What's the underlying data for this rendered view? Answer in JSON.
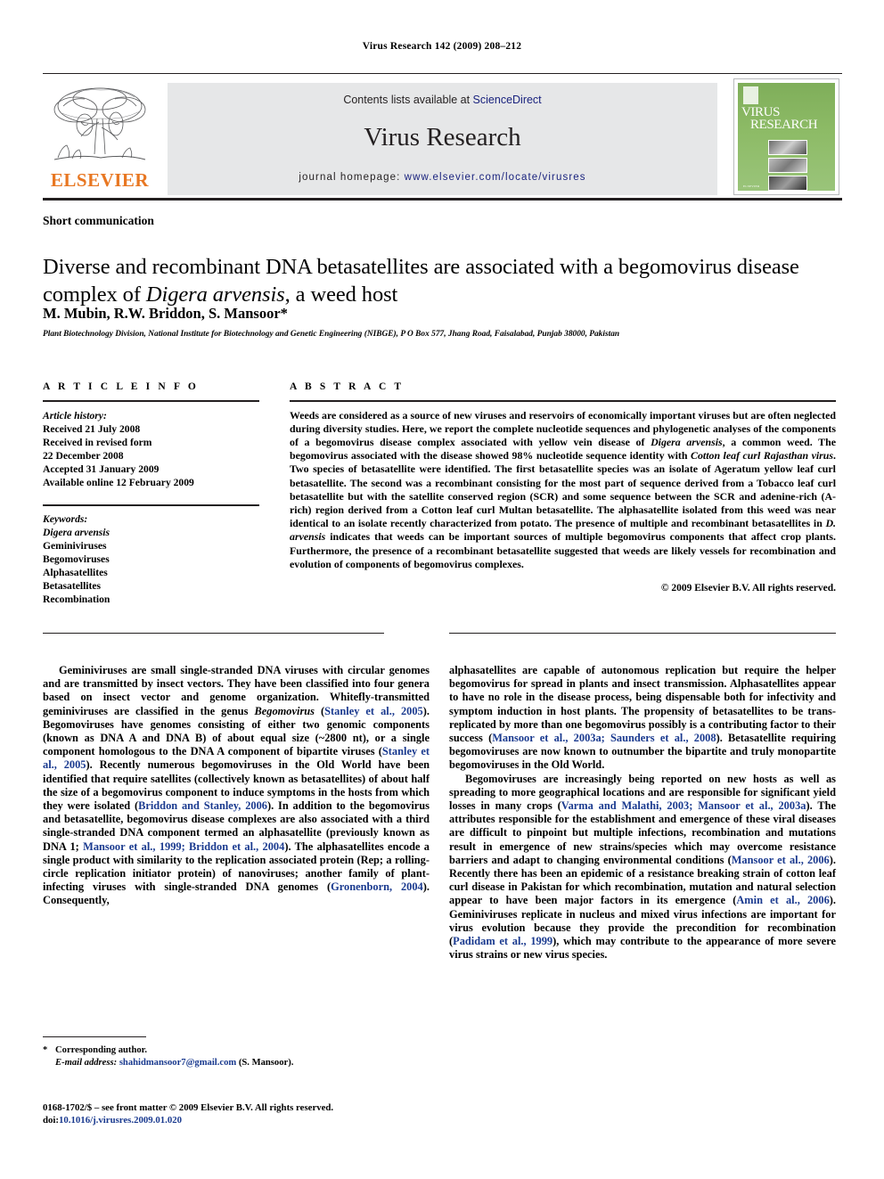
{
  "running_head": "Virus Research 142 (2009) 208–212",
  "masthead": {
    "contents_prefix": "Contents lists available at ",
    "sciencedirect": "ScienceDirect",
    "journal_name": "Virus Research",
    "homepage_prefix": "journal homepage: ",
    "homepage_url": "www.elsevier.com/locate/virusres",
    "publisher_wordmark": "ELSEVIER",
    "cover": {
      "title_line1": "VIRUS",
      "title_line2": "RESEARCH",
      "footer": "ELSEVIER"
    },
    "accent_green": "#8dbb66",
    "accent_orange": "#e87722",
    "link_blue": "#1a237e"
  },
  "article": {
    "section_type": "Short communication",
    "title_part1": "Diverse and recombinant DNA betasatellites are associated with a begomovirus disease complex of ",
    "title_italic": "Digera arvensis",
    "title_part2": ", a weed host",
    "authors": "M. Mubin, R.W. Briddon, S. Mansoor*",
    "affiliation": "Plant Biotechnology Division, National Institute for Biotechnology and Genetic Engineering (NIBGE), P O Box 577, Jhang Road, Faisalabad, Punjab 38000, Pakistan"
  },
  "article_info": {
    "heading": "A R T I C L E  I N F O",
    "history_label": "Article history:",
    "history": [
      "Received 21 July 2008",
      "Received in revised form",
      "22 December 2008",
      "Accepted 31 January 2009",
      "Available online 12 February 2009"
    ],
    "keywords_label": "Keywords:",
    "keywords_italic": "Digera arvensis",
    "keywords": [
      "Geminiviruses",
      "Begomoviruses",
      "Alphasatellites",
      "Betasatellites",
      "Recombination"
    ]
  },
  "abstract": {
    "heading": "A B S T R A C T",
    "p1": "Weeds are considered as a source of new viruses and reservoirs of economically important viruses but are often neglected during diversity studies. Here, we report the complete nucleotide sequences and phylogenetic analyses of the components of a begomovirus disease complex associated with yellow vein disease of ",
    "sp1": "Digera arvensis",
    "p2": ", a common weed. The begomovirus associated with the disease showed 98% nucleotide sequence identity with ",
    "sp2": "Cotton leaf curl Rajasthan virus",
    "p3": ". Two species of betasatellite were identified. The first betasatellite species was an isolate of Ageratum yellow leaf curl betasatellite. The second was a recombinant consisting for the most part of sequence derived from a Tobacco leaf curl betasatellite but with the satellite conserved region (SCR) and some sequence between the SCR and adenine-rich (A-rich) region derived from a Cotton leaf curl Multan betasatellite. The alphasatellite isolated from this weed was near identical to an isolate recently characterized from potato. The presence of multiple and recombinant betasatellites in ",
    "sp3": "D. arvensis",
    "p4": " indicates that weeds can be important sources of multiple begomovirus components that affect crop plants. Furthermore, the presence of a recombinant betasatellite suggested that weeds are likely vessels for recombination and evolution of components of begomovirus complexes.",
    "copyright": "© 2009 Elsevier B.V. All rights reserved."
  },
  "body": {
    "left_p1_a": "Geminiviruses are small single-stranded DNA viruses with circular genomes and are transmitted by insect vectors. They have been classified into four genera based on insect vector and genome organization. Whitefly-transmitted geminiviruses are classified in the genus ",
    "left_p1_genus": "Begomovirus",
    "left_p1_b": " (",
    "left_cite1": "Stanley et al., 2005",
    "left_p1_c": "). Begomoviruses have genomes consisting of either two genomic components (known as DNA A and DNA B) of about equal size (~2800 nt), or a single component homologous to the DNA A component of bipartite viruses (",
    "left_cite2": "Stanley et al., 2005",
    "left_p1_d": "). Recently numerous begomoviruses in the Old World have been identified that require satellites (collectively known as betasatellites) of about half the size of a begomovirus component to induce symptoms in the hosts from which they were isolated (",
    "left_cite3": "Briddon and Stanley, 2006",
    "left_p1_e": "). In addition to the begomovirus and betasatellite, begomovirus disease complexes are also associated with a third single-stranded DNA component termed an alphasatellite (previously known as DNA 1; ",
    "left_cite4": "Mansoor et al., 1999; Briddon et al., 2004",
    "left_p1_f": "). The alphasatellites encode a single product with similarity to the replication associated protein (Rep; a rolling-circle replication initiator protein) of nanoviruses; another family of plant-infecting viruses with single-stranded DNA genomes (",
    "left_cite5": "Gronenborn, 2004",
    "left_p1_g": "). Consequently,",
    "right_p1_a": "alphasatellites are capable of autonomous replication but require the helper begomovirus for spread in plants and insect transmission. Alphasatellites appear to have no role in the disease process, being dispensable both for infectivity and symptom induction in host plants. The propensity of betasatellites to be trans-replicated by more than one begomovirus possibly is a contributing factor to their success (",
    "right_cite1": "Mansoor et al., 2003a; Saunders et al., 2008",
    "right_p1_b": "). Betasatellite requiring begomoviruses are now known to outnumber the bipartite and truly monopartite begomoviruses in the Old World.",
    "right_p2_a": "Begomoviruses are increasingly being reported on new hosts as well as spreading to more geographical locations and are responsible for significant yield losses in many crops (",
    "right_cite2": "Varma and Malathi, 2003; Mansoor et al., 2003a",
    "right_p2_b": "). The attributes responsible for the establishment and emergence of these viral diseases are difficult to pinpoint but multiple infections, recombination and mutations result in emergence of new strains/species which may overcome resistance barriers and adapt to changing environmental conditions (",
    "right_cite3": "Mansoor et al., 2006",
    "right_p2_c": "). Recently there has been an epidemic of a resistance breaking strain of cotton leaf curl disease in Pakistan for which recombination, mutation and natural selection appear to have been major factors in its emergence (",
    "right_cite4": "Amin et al., 2006",
    "right_p2_d": "). Geminiviruses replicate in nucleus and mixed virus infections are important for virus evolution because they provide the precondition for recombination (",
    "right_cite5": "Padidam et al., 1999",
    "right_p2_e": "), which may contribute to the appearance of more severe virus strains or new virus species."
  },
  "footer": {
    "star": "*",
    "corresponding": "Corresponding author.",
    "email_label": "E-mail address:",
    "email": "shahidmansoor7@gmail.com",
    "email_suffix": " (S. Mansoor).",
    "issn_line": "0168-1702/$ – see front matter © 2009 Elsevier B.V. All rights reserved.",
    "doi_label": "doi:",
    "doi": "10.1016/j.virusres.2009.01.020"
  }
}
